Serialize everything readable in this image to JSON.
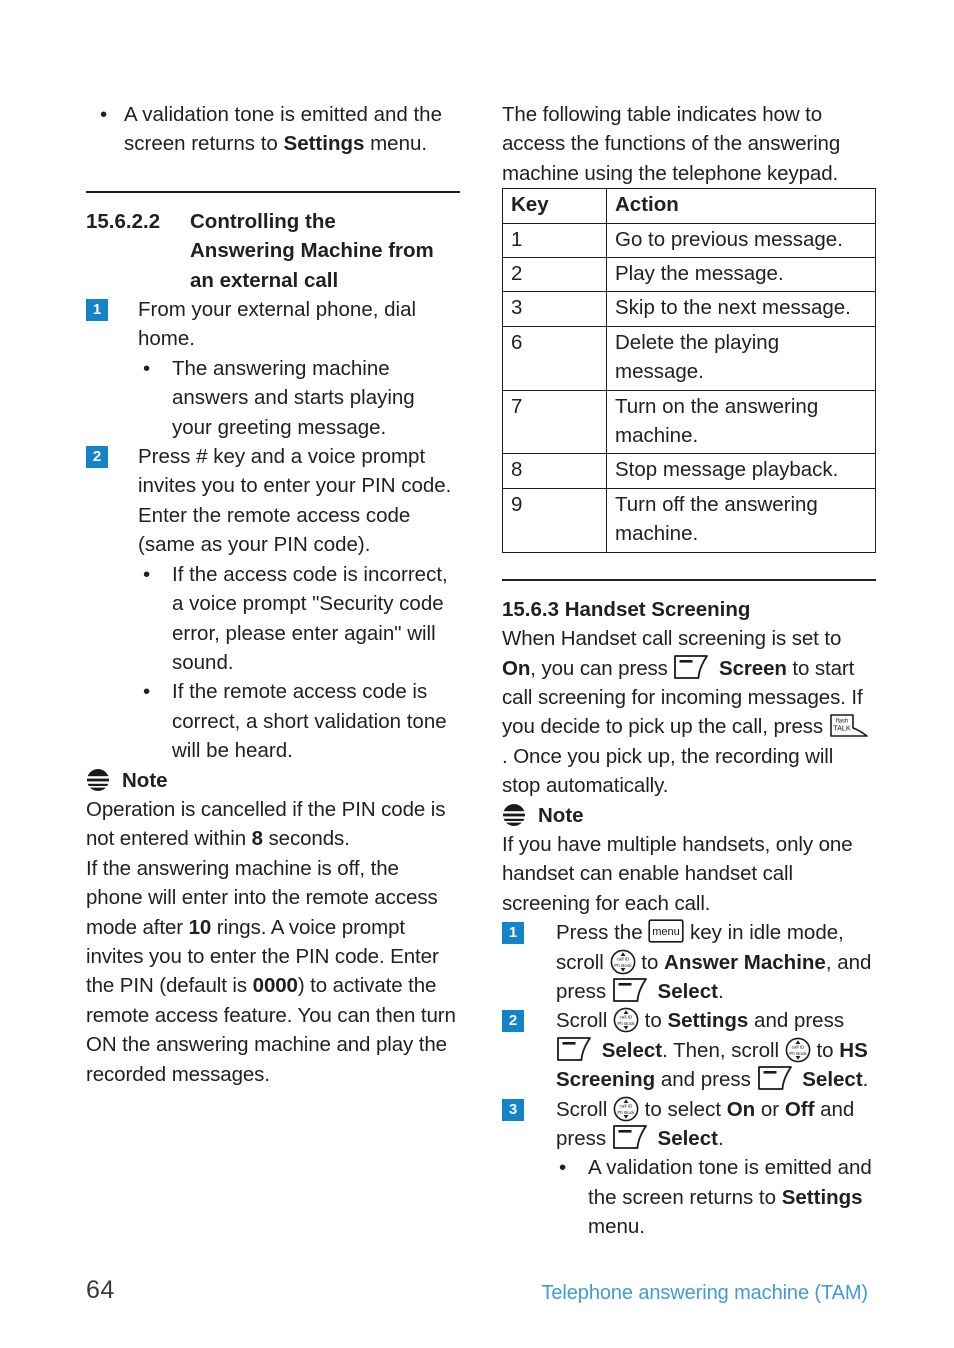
{
  "page": {
    "number": "64",
    "footer_title": "Telephone answering machine (TAM)",
    "accent_blue": "#1583c8",
    "footer_blue": "#3f9bd9"
  },
  "left_column": {
    "top_bullet": {
      "line1": "A validation tone is emitted and",
      "line2_pre": "the screen returns to ",
      "line2_bold": "Settings",
      "line3": "menu."
    },
    "section": {
      "number": "15.6.2.2",
      "title_line1": "Controlling the",
      "title_line2": "Answering Machine from",
      "title_line3": "an external call"
    },
    "step1": {
      "num": "1",
      "text": "From your external phone, dial home."
    },
    "step1_bullets": [
      "The answering machine answers and starts playing your greeting message."
    ],
    "step2": {
      "num": "2",
      "text": "Press # key and a voice prompt invites you to enter your PIN code. Enter the remote access code (same as your PIN code)."
    },
    "step2_bullets": [
      "If the access code is incorrect, a voice prompt \"Security code error, please enter again\" will sound.",
      "If the remote access code is correct, a short validation tone will be heard."
    ],
    "note": {
      "label": "Note",
      "icon": "note-icon",
      "para1_a": "Operation is cancelled if the PIN code is not entered within ",
      "para1_b": "8",
      "para1_c": " seconds.",
      "para2_a": "If the answering machine is off, the phone will enter into the remote access mode after ",
      "para2_b": "10",
      "para2_c": " rings. A voice prompt invites you to enter the PIN code. Enter the PIN (default is ",
      "para2_d": "0000",
      "para2_e": ") to activate the remote access feature. You can then turn ON the answering machine and play the recorded messages."
    }
  },
  "right_column": {
    "intro": "The following table indicates how to access the functions of the answering machine using the telephone keypad.",
    "table": {
      "headers": [
        "Key",
        "Action"
      ],
      "rows": [
        [
          "1",
          "Go to previous message."
        ],
        [
          "2",
          "Play the message."
        ],
        [
          "3",
          "Skip to the next message."
        ],
        [
          "6",
          "Delete the playing message."
        ],
        [
          "7",
          "Turn on the answering machine."
        ],
        [
          "8",
          "Stop message playback."
        ],
        [
          "9",
          "Turn off the answering machine."
        ]
      ]
    },
    "section": {
      "number": "15.6.3",
      "title": "Handset Screening"
    },
    "intro2": {
      "a": "When Handset call screening is set to ",
      "b_on": "On",
      "c": ", you can press ",
      "icon_softkey": "softkey-icon",
      "d_screen": "Screen",
      "e": " to start call screening for incoming messages. If you decide to pick up the call, press ",
      "icon_talk": "talk-key-icon",
      "f": ". Once you pick up, the recording will stop automatically."
    },
    "note": {
      "label": "Note",
      "icon": "note-icon",
      "text": "If you have multiple handsets, only one handset can enable handset call screening for each call."
    },
    "step1": {
      "num": "1",
      "a": "Press the ",
      "icon_menu": "menu-key-icon",
      "b": " key in idle mode, scroll ",
      "icon_nav": "nav-scroll-icon",
      "c": " to ",
      "d_bold": "Answer Machine",
      "e": ", and press ",
      "icon_softkey": "softkey-icon",
      "f_bold": "Select",
      "g": "."
    },
    "step2": {
      "num": "2",
      "a": "Scroll ",
      "icon_nav": "nav-scroll-icon",
      "b": " to ",
      "c_bold": "Settings",
      "d": " and press ",
      "icon_softkey": "softkey-icon",
      "e_bold": "Select",
      "f": ". Then, scroll ",
      "icon_nav2": "nav-scroll-icon",
      "g": " to ",
      "h_bold": "HS Screening",
      "i": " and press ",
      "icon_softkey2": "softkey-icon",
      "j_bold": "Select",
      "k": "."
    },
    "step3": {
      "num": "3",
      "a": "Scroll ",
      "icon_nav": "nav-scroll-icon",
      "b": " to select ",
      "c_bold": "On",
      "d": " or ",
      "e_bold": "Off",
      "f": " and press ",
      "icon_softkey": "softkey-icon",
      "g_bold": "Select",
      "h": "."
    },
    "step3_bullet": {
      "line1": "A validation tone is emitted and",
      "line2_pre": "the screen returns to ",
      "line2_bold": "Settings",
      "line3": "menu."
    }
  },
  "icons": {
    "note": "note-icon",
    "softkey": "softkey-icon",
    "nav": "nav-scroll-icon",
    "menu_key_label": "menu",
    "talk_key_label_top": "flash",
    "talk_key_label_bottom": "TALK",
    "nav_key_label_top": "call ID",
    "nav_key_label_bottom": "Ph Book"
  }
}
